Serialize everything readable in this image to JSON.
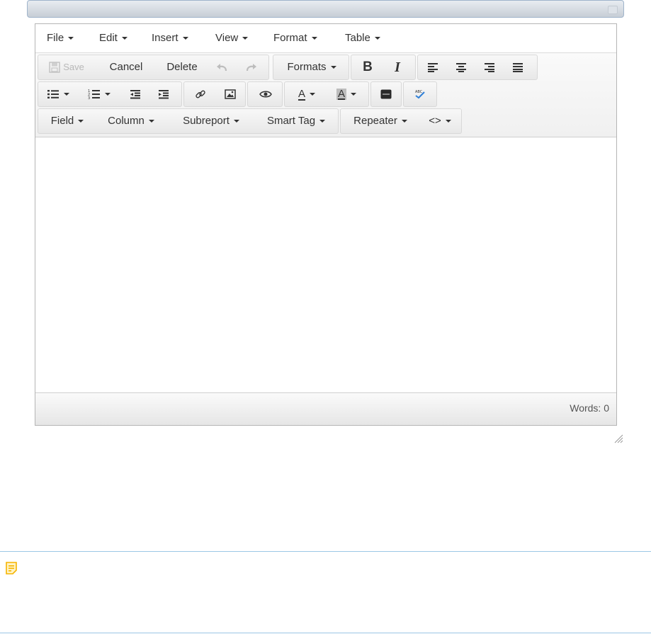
{
  "menubar": {
    "items": [
      {
        "label": "File"
      },
      {
        "label": "Edit"
      },
      {
        "label": "Insert"
      },
      {
        "label": "View"
      },
      {
        "label": "Format"
      },
      {
        "label": "Table"
      }
    ]
  },
  "toolbar": {
    "save_label": "Save",
    "cancel_label": "Cancel",
    "delete_label": "Delete",
    "formats_label": "Formats",
    "bold_label": "B",
    "italic_label": "I",
    "text_color_label": "A",
    "bg_color_label": "A",
    "field_label": "Field",
    "column_label": "Column",
    "subreport_label": "Subreport",
    "smarttag_label": "Smart Tag",
    "repeater_label": "Repeater",
    "code_label": "<>"
  },
  "icons": {
    "undo": "undo-icon",
    "redo": "redo-icon",
    "align_left": "align-left-icon",
    "align_center": "align-center-icon",
    "align_right": "align-right-icon",
    "align_justify": "align-justify-icon",
    "bullet_list": "bullet-list-icon",
    "numbered_list": "numbered-list-icon",
    "outdent": "outdent-icon",
    "indent": "indent-icon",
    "link": "link-icon",
    "image": "image-icon",
    "preview": "eye-icon",
    "html": "html-source-icon",
    "spellcheck": "spellcheck-icon",
    "note": "note-icon"
  },
  "colors": {
    "note_accent": "#f5b400",
    "note_border": "#9cc7e5",
    "spell_check": "#2f7fd6"
  },
  "statusbar": {
    "word_count": "Words: 0"
  }
}
